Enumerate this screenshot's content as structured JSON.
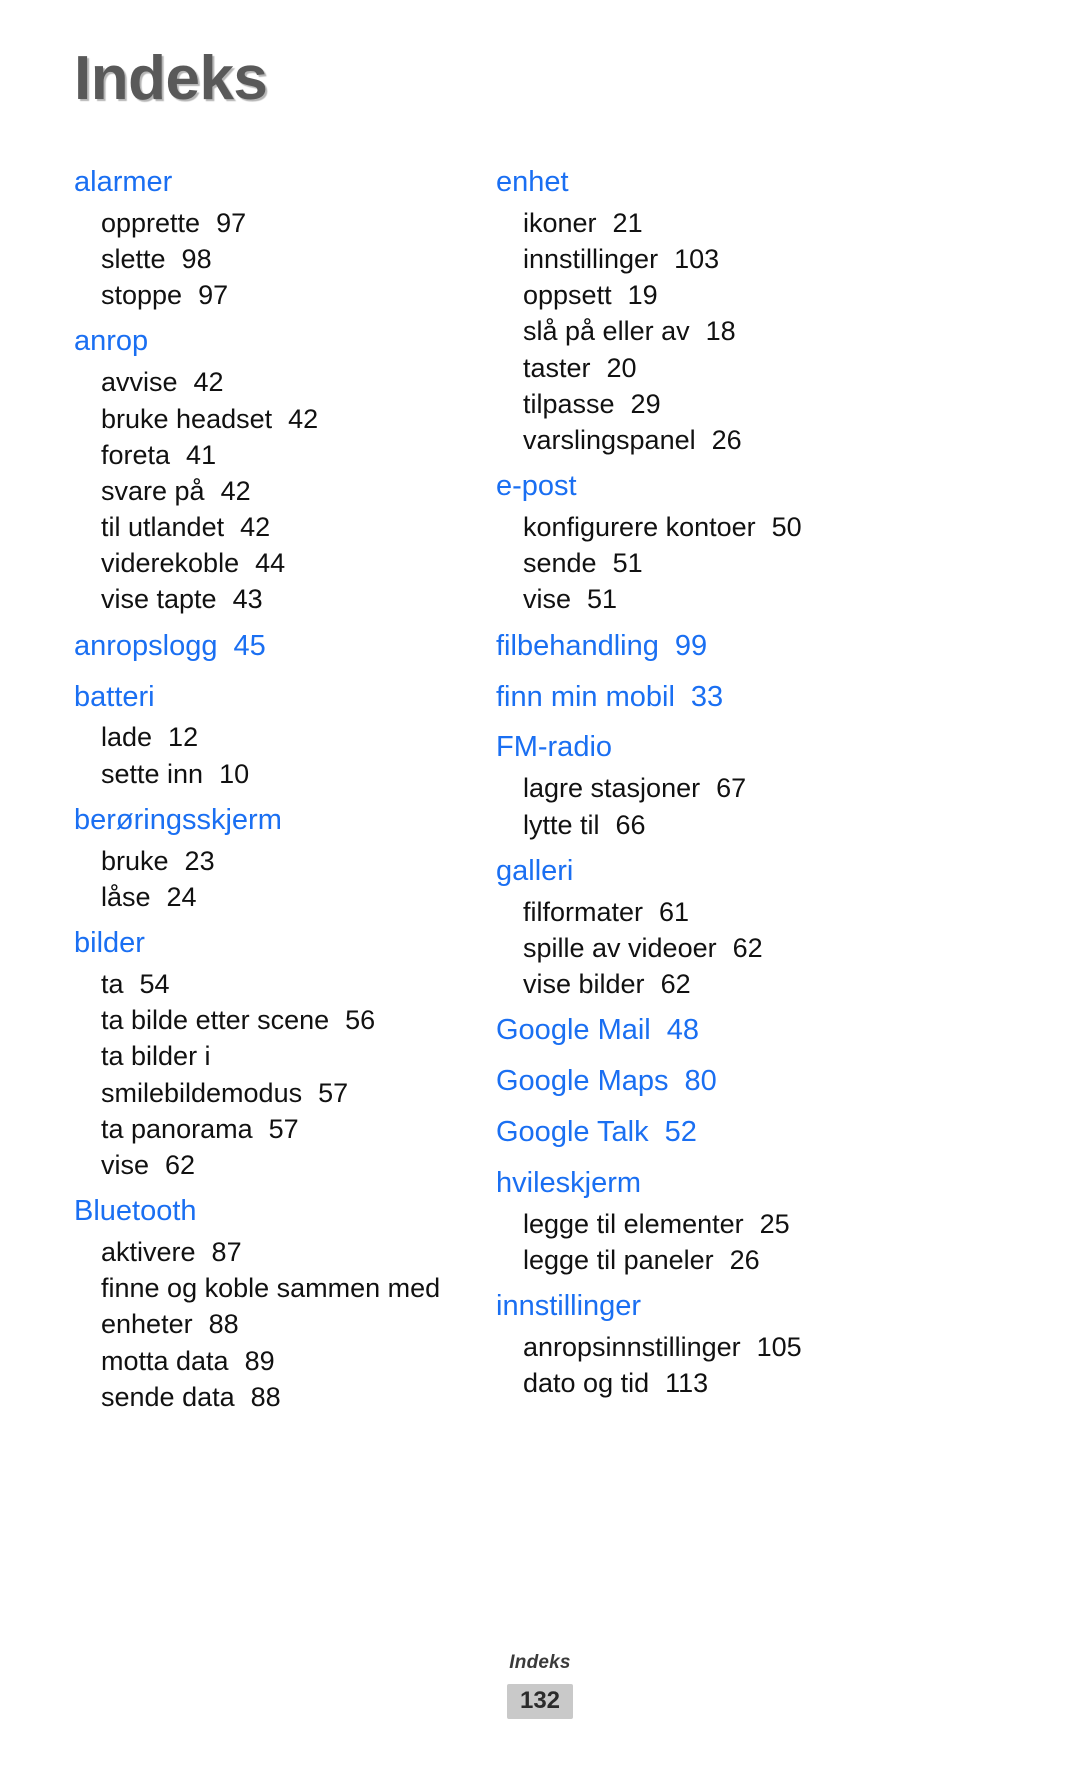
{
  "document": {
    "title": "Indeks",
    "footer_label": "Indeks",
    "page_number": "132",
    "accent_color": "#1a6ff2",
    "title_color": "#595959",
    "body_color": "#111111",
    "page_badge_bg": "#c9c9c9"
  },
  "columns": [
    {
      "side": "left",
      "groups": [
        {
          "head": "alarmer",
          "head_page": "",
          "entries": [
            {
              "label": "opprette",
              "page": "97"
            },
            {
              "label": "slette",
              "page": "98"
            },
            {
              "label": "stoppe",
              "page": "97"
            }
          ]
        },
        {
          "head": "anrop",
          "head_page": "",
          "entries": [
            {
              "label": "avvise",
              "page": "42"
            },
            {
              "label": "bruke headset",
              "page": "42"
            },
            {
              "label": "foreta",
              "page": "41"
            },
            {
              "label": "svare på",
              "page": "42"
            },
            {
              "label": "til utlandet",
              "page": "42"
            },
            {
              "label": "viderekoble",
              "page": "44"
            },
            {
              "label": "vise tapte",
              "page": "43"
            }
          ]
        },
        {
          "head": "anropslogg",
          "head_page": "45",
          "entries": []
        },
        {
          "head": "batteri",
          "head_page": "",
          "entries": [
            {
              "label": "lade",
              "page": "12"
            },
            {
              "label": "sette inn",
              "page": "10"
            }
          ]
        },
        {
          "head": "berøringsskjerm",
          "head_page": "",
          "entries": [
            {
              "label": "bruke",
              "page": "23"
            },
            {
              "label": "låse",
              "page": "24"
            }
          ]
        },
        {
          "head": "bilder",
          "head_page": "",
          "entries": [
            {
              "label": "ta",
              "page": "54"
            },
            {
              "label": "ta bilde etter scene",
              "page": "56"
            },
            {
              "label": "ta bilder i",
              "page": ""
            },
            {
              "label": "smilebildemodus",
              "page": "57"
            },
            {
              "label": "ta panorama",
              "page": "57"
            },
            {
              "label": "vise",
              "page": "62"
            }
          ]
        },
        {
          "head": "Bluetooth",
          "head_page": "",
          "entries": [
            {
              "label": "aktivere",
              "page": "87"
            },
            {
              "label": "finne og koble sammen med",
              "page": ""
            },
            {
              "label": "enheter",
              "page": "88"
            },
            {
              "label": "motta data",
              "page": "89"
            },
            {
              "label": "sende data",
              "page": "88"
            }
          ]
        }
      ]
    },
    {
      "side": "right",
      "groups": [
        {
          "head": "enhet",
          "head_page": "",
          "entries": [
            {
              "label": "ikoner",
              "page": "21"
            },
            {
              "label": "innstillinger",
              "page": "103"
            },
            {
              "label": "oppsett",
              "page": "19"
            },
            {
              "label": "slå på eller av",
              "page": "18"
            },
            {
              "label": "taster",
              "page": "20"
            },
            {
              "label": "tilpasse",
              "page": "29"
            },
            {
              "label": "varslingspanel",
              "page": "26"
            }
          ]
        },
        {
          "head": "e-post",
          "head_page": "",
          "entries": [
            {
              "label": "konfigurere kontoer",
              "page": "50"
            },
            {
              "label": "sende",
              "page": "51"
            },
            {
              "label": "vise",
              "page": "51"
            }
          ]
        },
        {
          "head": "filbehandling",
          "head_page": "99",
          "entries": []
        },
        {
          "head": "finn min mobil",
          "head_page": "33",
          "entries": []
        },
        {
          "head": "FM-radio",
          "head_page": "",
          "entries": [
            {
              "label": "lagre stasjoner",
              "page": "67"
            },
            {
              "label": "lytte til",
              "page": "66"
            }
          ]
        },
        {
          "head": "galleri",
          "head_page": "",
          "entries": [
            {
              "label": "filformater",
              "page": "61"
            },
            {
              "label": "spille av videoer",
              "page": "62"
            },
            {
              "label": "vise bilder",
              "page": "62"
            }
          ]
        },
        {
          "head": "Google Mail",
          "head_page": "48",
          "entries": []
        },
        {
          "head": "Google Maps",
          "head_page": "80",
          "entries": []
        },
        {
          "head": "Google Talk",
          "head_page": "52",
          "entries": []
        },
        {
          "head": "hvileskjerm",
          "head_page": "",
          "entries": [
            {
              "label": "legge til elementer",
              "page": "25"
            },
            {
              "label": "legge til paneler",
              "page": "26"
            }
          ]
        },
        {
          "head": "innstillinger",
          "head_page": "",
          "entries": [
            {
              "label": "anropsinnstillinger",
              "page": "105"
            },
            {
              "label": "dato og tid",
              "page": "113"
            }
          ]
        }
      ]
    }
  ]
}
